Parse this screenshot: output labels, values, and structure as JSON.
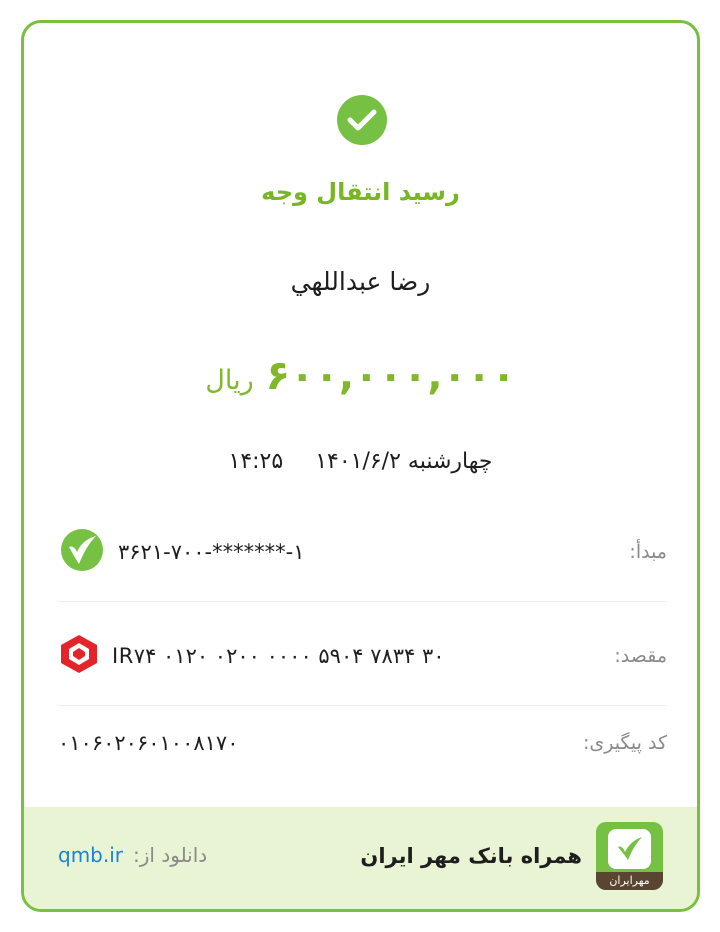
{
  "receipt": {
    "title": "رسید انتقال وجه",
    "recipient_name": "رضا عبداللهي",
    "amount": "۶۰۰,۰۰۰,۰۰۰",
    "currency": "ریال",
    "date": "چهارشنبه ۱۴۰۱/۶/۲",
    "time": "۱۴:۲۵",
    "status_icon": "check-icon",
    "accent_color": "#76c044"
  },
  "source": {
    "label": "مبدأ:",
    "value": "۳۶۲۱-۷۰۰-*******-۱",
    "icon": "mehr-bank-logo-icon"
  },
  "destination": {
    "label": "مقصد:",
    "value": "IR۷۴ ۰۱۲۰ ۰۲۰۰ ۰۰۰۰ ۵۹۰۴ ۷۸۳۴ ۳۰",
    "icon": "mellat-bank-logo-icon"
  },
  "tracking": {
    "label": "کد پیگیری:",
    "value": "۰۱۰۶۰۲۰۶۰۱۰۰۸۱۷۰"
  },
  "footer": {
    "download_label": "دانلود از:",
    "download_link": "qmb.ir",
    "brand_name": "همراه بانک مهر ایران",
    "logo_text": "مهرایران",
    "link_color": "#1a83d6",
    "background_color": "#e8f4d3"
  }
}
